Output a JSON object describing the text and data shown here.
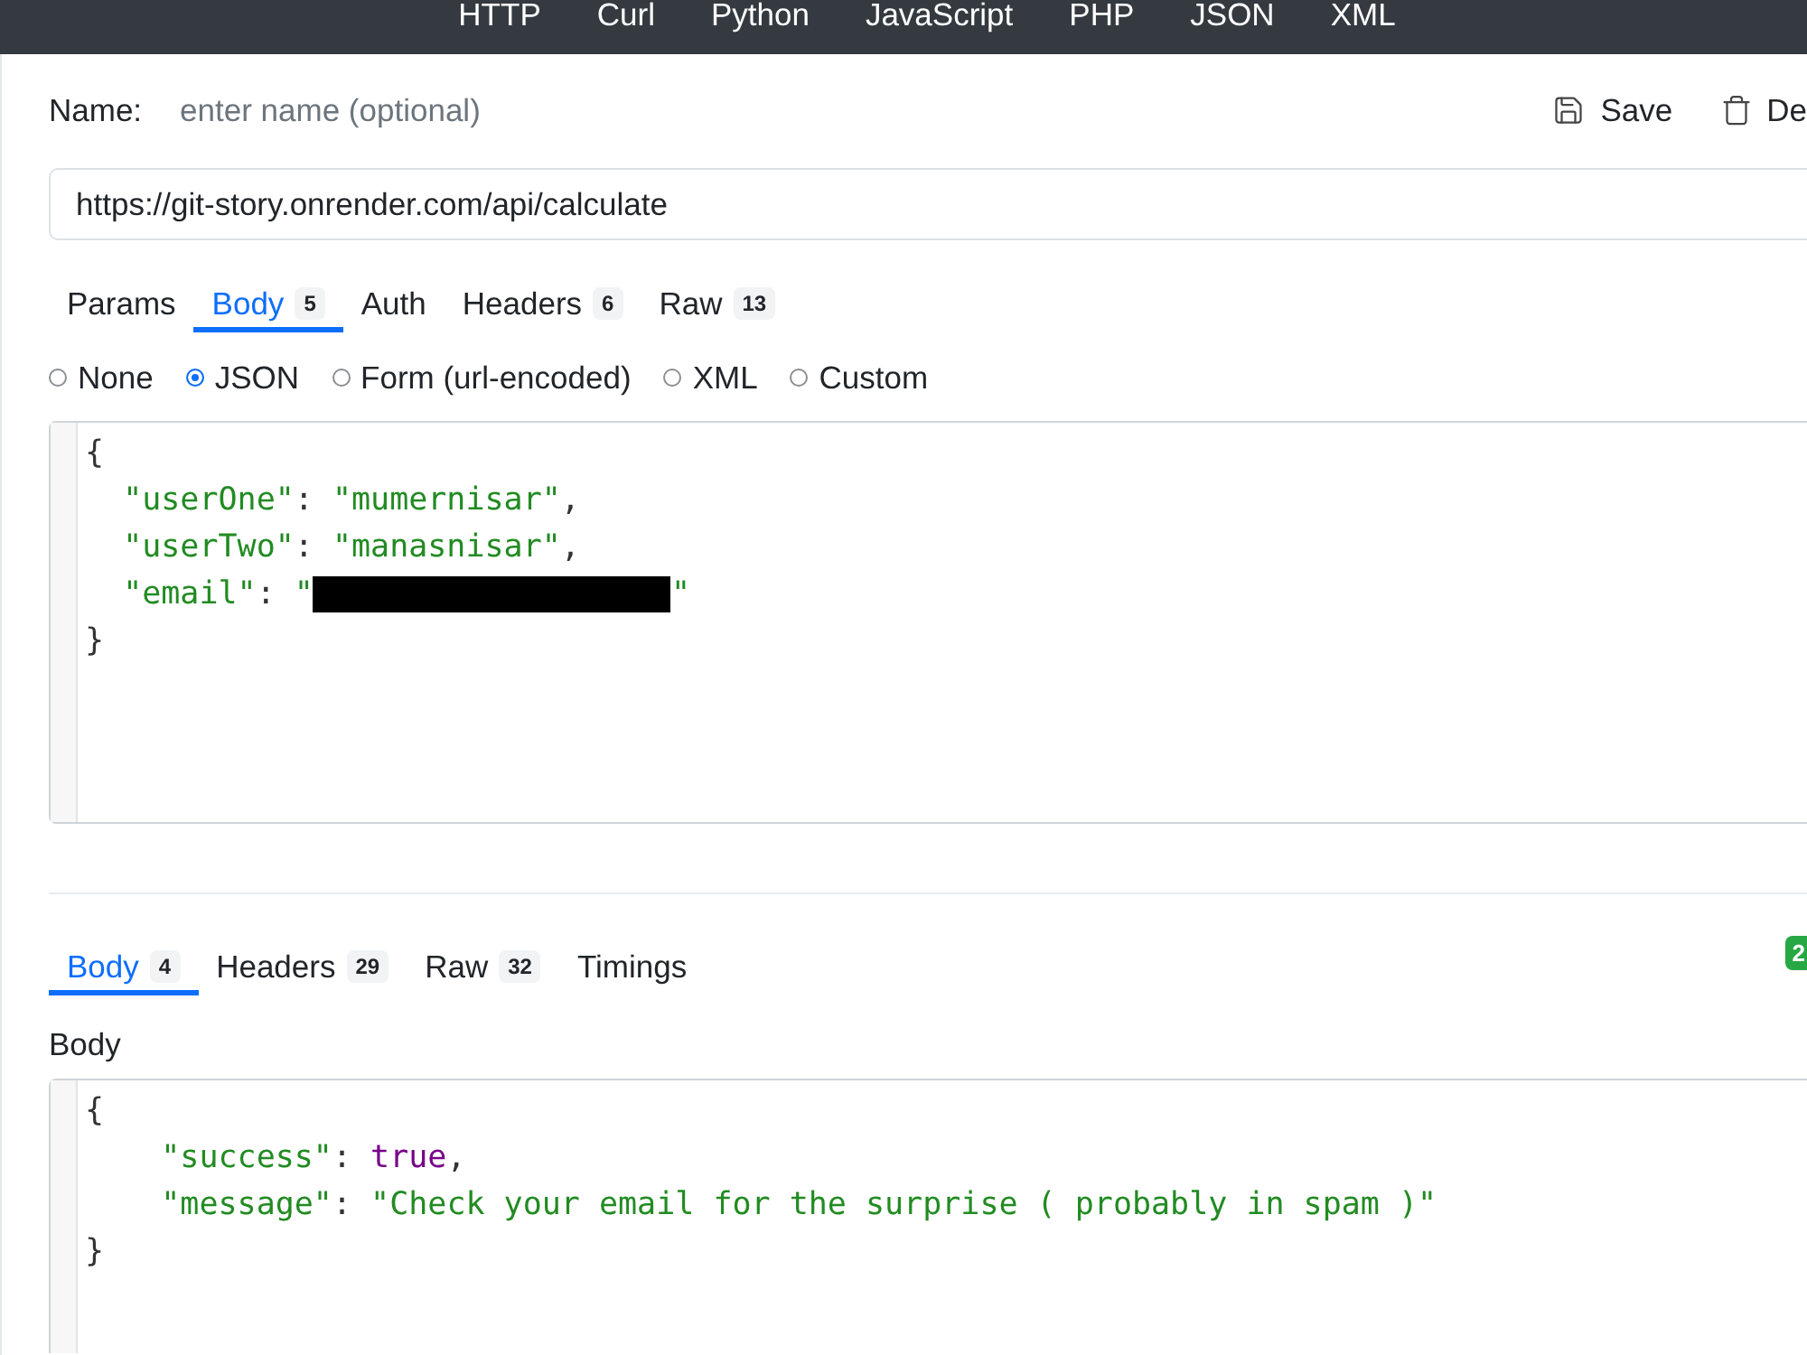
{
  "top_nav": {
    "items": [
      "HTTP",
      "Curl",
      "Python",
      "JavaScript",
      "PHP",
      "JSON",
      "XML"
    ]
  },
  "request": {
    "name_label": "Name:",
    "name_field": {
      "placeholder": "enter name (optional)"
    },
    "actions": [
      {
        "kind": "save",
        "label": "Save"
      },
      {
        "kind": "delete",
        "label": "De"
      }
    ],
    "url_field": {
      "value": "https://git-story.onrender.com/api/calculate"
    },
    "tabs": [
      {
        "label": "Params",
        "selected": false
      },
      {
        "label": "Body",
        "count": "5",
        "selected": true
      },
      {
        "label": "Auth",
        "selected": false
      },
      {
        "label": "Headers",
        "count": "6",
        "selected": false
      },
      {
        "label": "Raw",
        "count": "13",
        "selected": false
      }
    ],
    "body_types": [
      {
        "label": "None",
        "selected": false
      },
      {
        "label": "JSON",
        "selected": true
      },
      {
        "label": "Form (url-encoded)",
        "selected": false
      },
      {
        "label": "XML",
        "selected": false
      },
      {
        "label": "Custom",
        "selected": false
      }
    ],
    "editor": {
      "lines": [
        {
          "tokens": [
            {
              "kind": "punct",
              "text": "{"
            }
          ],
          "children": [
            {
              "tokens": [
                {
                  "kind": "key",
                  "text": "\"userOne\""
                },
                {
                  "kind": "punct",
                  "text": ": "
                },
                {
                  "kind": "string",
                  "text": "\"mumernisar\""
                },
                {
                  "kind": "punct",
                  "text": ","
                }
              ]
            },
            {
              "tokens": [
                {
                  "kind": "key",
                  "text": "\"userTwo\""
                },
                {
                  "kind": "punct",
                  "text": ": "
                },
                {
                  "kind": "string",
                  "text": "\"manasnisar\""
                },
                {
                  "kind": "punct",
                  "text": ","
                }
              ]
            },
            {
              "tokens": [
                {
                  "kind": "key",
                  "text": "\"email\""
                },
                {
                  "kind": "punct",
                  "text": ": "
                },
                {
                  "kind": "string",
                  "text": "\""
                },
                {
                  "kind": "redacted"
                },
                {
                  "kind": "string",
                  "text": "\""
                }
              ]
            }
          ]
        },
        {
          "tokens": [
            {
              "kind": "punct",
              "text": "}"
            }
          ]
        }
      ]
    }
  },
  "response": {
    "tabs": [
      {
        "label": "Body",
        "count": "4",
        "selected": true
      },
      {
        "label": "Headers",
        "count": "29",
        "selected": false
      },
      {
        "label": "Raw",
        "count": "32",
        "selected": false
      },
      {
        "label": "Timings",
        "selected": false
      }
    ],
    "status_badge": "2",
    "section_label": "Body",
    "editor": {
      "lines": [
        {
          "tokens": [
            {
              "kind": "punct",
              "text": "{"
            }
          ],
          "children": [
            {
              "tokens": [
                {
                  "kind": "key",
                  "text": "\"success\""
                },
                {
                  "kind": "punct",
                  "text": ": "
                },
                {
                  "kind": "bool",
                  "text": "true"
                },
                {
                  "kind": "punct",
                  "text": ","
                }
              ]
            },
            {
              "tokens": [
                {
                  "kind": "key",
                  "text": "\"message\""
                },
                {
                  "kind": "punct",
                  "text": ": "
                },
                {
                  "kind": "string",
                  "text": "\"Check your email for the surprise ( probably in spam )\""
                }
              ]
            }
          ]
        },
        {
          "tokens": [
            {
              "kind": "punct",
              "text": "}"
            }
          ]
        }
      ]
    }
  }
}
